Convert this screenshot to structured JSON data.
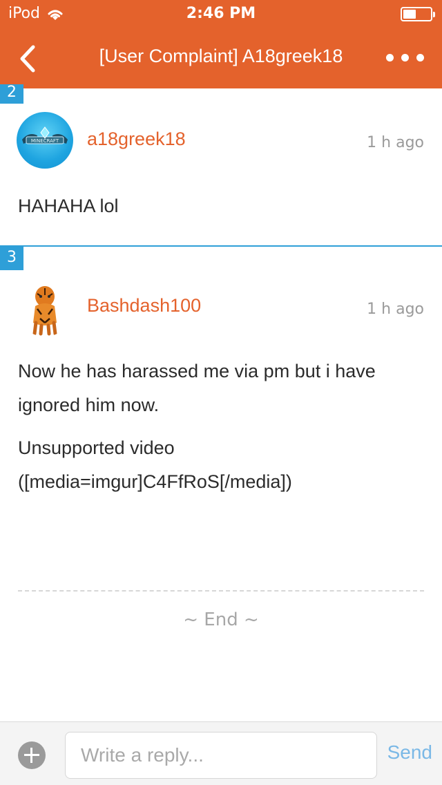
{
  "status_bar": {
    "carrier": "iPod",
    "time": "2:46 PM",
    "battery_level": 0.4
  },
  "nav": {
    "title": "[User Complaint] A18greek18",
    "back_icon": "chevron-left-icon",
    "more_icon": "ellipsis-icon"
  },
  "posts": [
    {
      "number": "2",
      "username": "a18greek18",
      "time": "1 h ago",
      "avatar_label": "MINECRAFT",
      "paragraphs": [
        "HAHAHA lol"
      ]
    },
    {
      "number": "3",
      "username": "Bashdash100",
      "time": "1 h ago",
      "paragraphs": [
        "Now he has harassed me via pm but i have ignored him now.",
        "Unsupported video ([media=imgur]C4FfRoS[/media])"
      ]
    }
  ],
  "end_label": "~ End ~",
  "reply": {
    "placeholder": "Write a reply...",
    "send_label": "Send"
  },
  "colors": {
    "accent": "#e4622c",
    "post_number": "#2e9fd8",
    "send": "#7ab8e6"
  }
}
